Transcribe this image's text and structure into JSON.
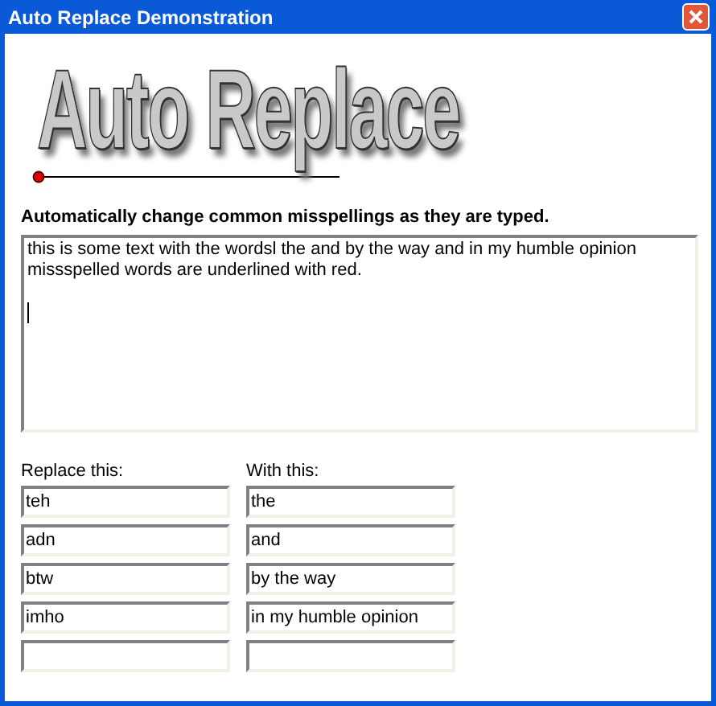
{
  "window": {
    "title": "Auto Replace Demonstration"
  },
  "logo": {
    "text": "Auto Replace"
  },
  "heading": "Automatically change common misspellings as they are typed.",
  "editor": {
    "value": "this is some text with the wordsl the and by the way and in my humble opinion missspelled words are underlined with red.",
    "caret": true
  },
  "columns": [
    "Replace this:",
    "With this:"
  ],
  "rows": [
    {
      "replace": "teh",
      "with": "the"
    },
    {
      "replace": "adn",
      "with": "and"
    },
    {
      "replace": "btw",
      "with": "by the way"
    },
    {
      "replace": "imho",
      "with": "in my humble opinion"
    },
    {
      "replace": "",
      "with": ""
    }
  ]
}
